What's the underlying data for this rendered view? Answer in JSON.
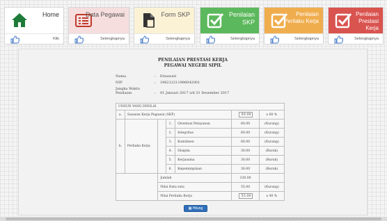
{
  "tiles": [
    {
      "title": "Home",
      "link": "Klik",
      "color": "#ffffff",
      "text_color": "#333333",
      "icon": "home-icon"
    },
    {
      "title": "Data Pegawai",
      "link": "Selengkapnya",
      "color": "#f6dede",
      "text_color": "#555555",
      "icon": "list-icon"
    },
    {
      "title": "Form SKP",
      "link": "Selengkapnya",
      "color": "#fbf2d6",
      "text_color": "#555555",
      "icon": "document-icon"
    },
    {
      "title": "Penilaian SKP",
      "link": "Selengkapnya",
      "color": "#5cb85c",
      "text_color": "#ffffff",
      "icon": "checkbox-icon"
    },
    {
      "title": "Penilaian Perilaku Kerja",
      "link": "Selengkapnya",
      "color": "#f0ad4e",
      "text_color": "#ffffff",
      "icon": "checkbox-icon"
    },
    {
      "title": "Penilaian Prestasi Kerja",
      "link": "Selengkapnya",
      "color": "#d9534f",
      "text_color": "#ffffff",
      "icon": "checkbox-icon"
    }
  ],
  "doc": {
    "title1": "PENILAIAN PRESTASI KERJA",
    "title2": "PEGAWAI NEGERI SIPIL",
    "info": [
      {
        "label": "Nama",
        "value": "Ernawati"
      },
      {
        "label": "NIP",
        "value": "196212211986042001"
      },
      {
        "label": "Jangka Waktu Penilaian",
        "value": "01 Januari 2017  s/d  31 Desember 2017"
      }
    ]
  },
  "table": {
    "header": "UNSUR YANG DINILAI",
    "a_label": "a.",
    "a_name": "Sasaran Kerja Pegawai (SKP)",
    "a_value": "99.99",
    "a_pct": "x 60 %",
    "b_label": "b.",
    "b_name": "Perilaku Kerja",
    "items": [
      {
        "no": "1.",
        "name": "Orientasi Pelayanan",
        "value": "60.00",
        "cat": "(Kurang)"
      },
      {
        "no": "2.",
        "name": "Integritas",
        "value": "60.00",
        "cat": "(Kurang)"
      },
      {
        "no": "3.",
        "name": "Komitmen",
        "value": "60.00",
        "cat": "(Kurang)"
      },
      {
        "no": "4.",
        "name": "Disiplin",
        "value": "30.00",
        "cat": "(Buruk)"
      },
      {
        "no": "5.",
        "name": "Kerjasama",
        "value": "30.00",
        "cat": "(Buruk)"
      },
      {
        "no": "6.",
        "name": "Kepemimpinan",
        "value": "30.00",
        "cat": "(Buruk)"
      }
    ],
    "jumlah_label": "Jumlah",
    "jumlah_value": "330.00",
    "rata_label": "Nilai Rata-rata",
    "rata_value": "55.00",
    "rata_cat": "(Kurang)",
    "nilai_label": "Nilai Perilaku Kerja",
    "nilai_value": "55.00",
    "nilai_pct": "x 40 %"
  },
  "button": {
    "label": "Hitung"
  }
}
